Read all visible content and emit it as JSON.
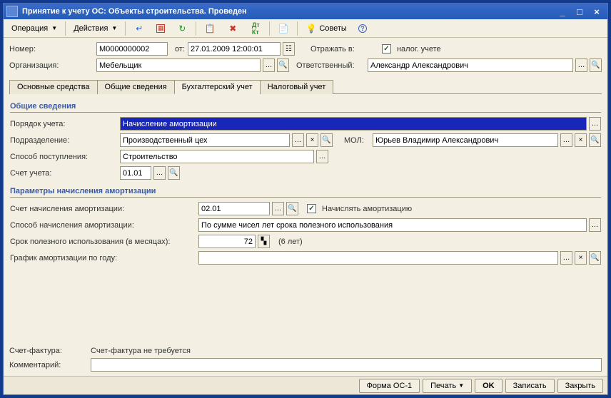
{
  "window": {
    "title": "Принятие к учету ОС: Объекты строительства. Проведен"
  },
  "toolbar": {
    "operation": "Операция",
    "actions": "Действия",
    "tips": "Советы"
  },
  "header": {
    "number_label": "Номер:",
    "number": "М0000000002",
    "from_label": "от:",
    "date": "27.01.2009 12:00:01",
    "reflect_label": "Отражать в:",
    "tax_account": "налог. учете",
    "org_label": "Организация:",
    "org": "Мебельщик",
    "responsible_label": "Ответственный:",
    "responsible": "Александр Александрович"
  },
  "tabs": {
    "t1": "Основные средства",
    "t2": "Общие сведения",
    "t3": "Бухгалтерский учет",
    "t4": "Налоговый учет"
  },
  "section1": {
    "title": "Общие сведения",
    "order_label": "Порядок учета:",
    "order": "Начисление амортизации",
    "subdiv_label": "Подразделение:",
    "subdiv": "Производственный цех",
    "mol_label": "МОЛ:",
    "mol": "Юрьев Владимир Александрович",
    "receipt_label": "Способ поступления:",
    "receipt": "Строительство",
    "account_label": "Счет учета:",
    "account": "01.01"
  },
  "section2": {
    "title": "Параметры начисления амортизации",
    "amort_acc_label": "Счет начисления амортизации:",
    "amort_acc": "02.01",
    "do_amort": "Начислять амортизацию",
    "method_label": "Способ начисления амортизации:",
    "method": "По сумме чисел лет срока полезного использования",
    "term_label": "Срок полезного использования (в месяцах):",
    "term": "72",
    "term_years": "(6 лет)",
    "schedule_label": "График амортизации по году:"
  },
  "bottom": {
    "invoice_label": "Счет-фактура:",
    "invoice": "Счет-фактура не требуется",
    "comment_label": "Комментарий:"
  },
  "footer": {
    "form": "Форма ОС-1",
    "print": "Печать",
    "ok": "OK",
    "save": "Записать",
    "close": "Закрыть"
  }
}
